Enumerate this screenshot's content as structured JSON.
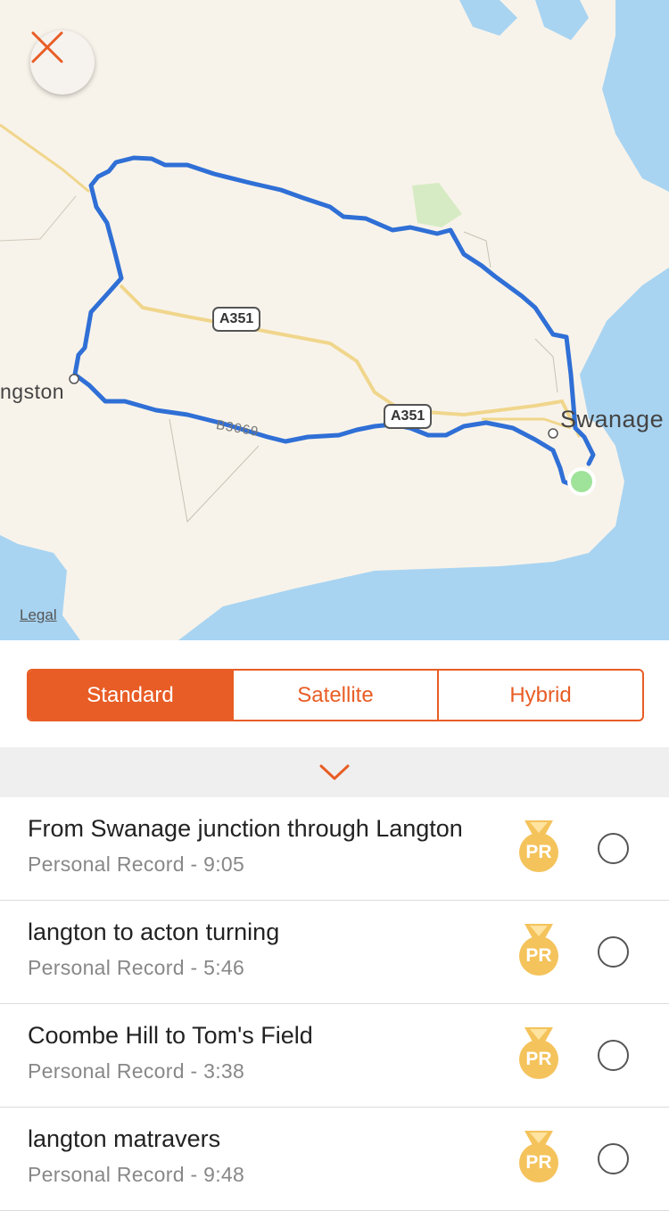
{
  "map": {
    "legal_label": "Legal",
    "place_labels": {
      "langton": "ngston",
      "swanage": "Swanage"
    },
    "road_shields": {
      "a351_upper": "A351",
      "a351_lower": "A351"
    },
    "road_names": {
      "b3069": "B3069"
    },
    "colors": {
      "route": "#2f6fd6",
      "water": "#a8d4f2",
      "land": "#f8f3ea",
      "start_marker": "#9fe39a"
    }
  },
  "close_button": {
    "icon": "close-icon",
    "color": "#e85d25"
  },
  "map_type_control": {
    "options": [
      "Standard",
      "Satellite",
      "Hybrid"
    ],
    "selected": "Standard",
    "accent": "#e85d25"
  },
  "collapse_bar": {
    "icon": "chevron-down-icon"
  },
  "segments": [
    {
      "title": "From Swanage junction through Langton",
      "subtitle": "Personal Record - 9:05",
      "badge": "PR"
    },
    {
      "title": "langton to acton turning",
      "subtitle": "Personal Record - 5:46",
      "badge": "PR"
    },
    {
      "title": "Coombe Hill to Tom's Field",
      "subtitle": "Personal Record - 3:38",
      "badge": "PR"
    },
    {
      "title": "langton matravers",
      "subtitle": "Personal Record - 9:48",
      "badge": "PR"
    }
  ]
}
